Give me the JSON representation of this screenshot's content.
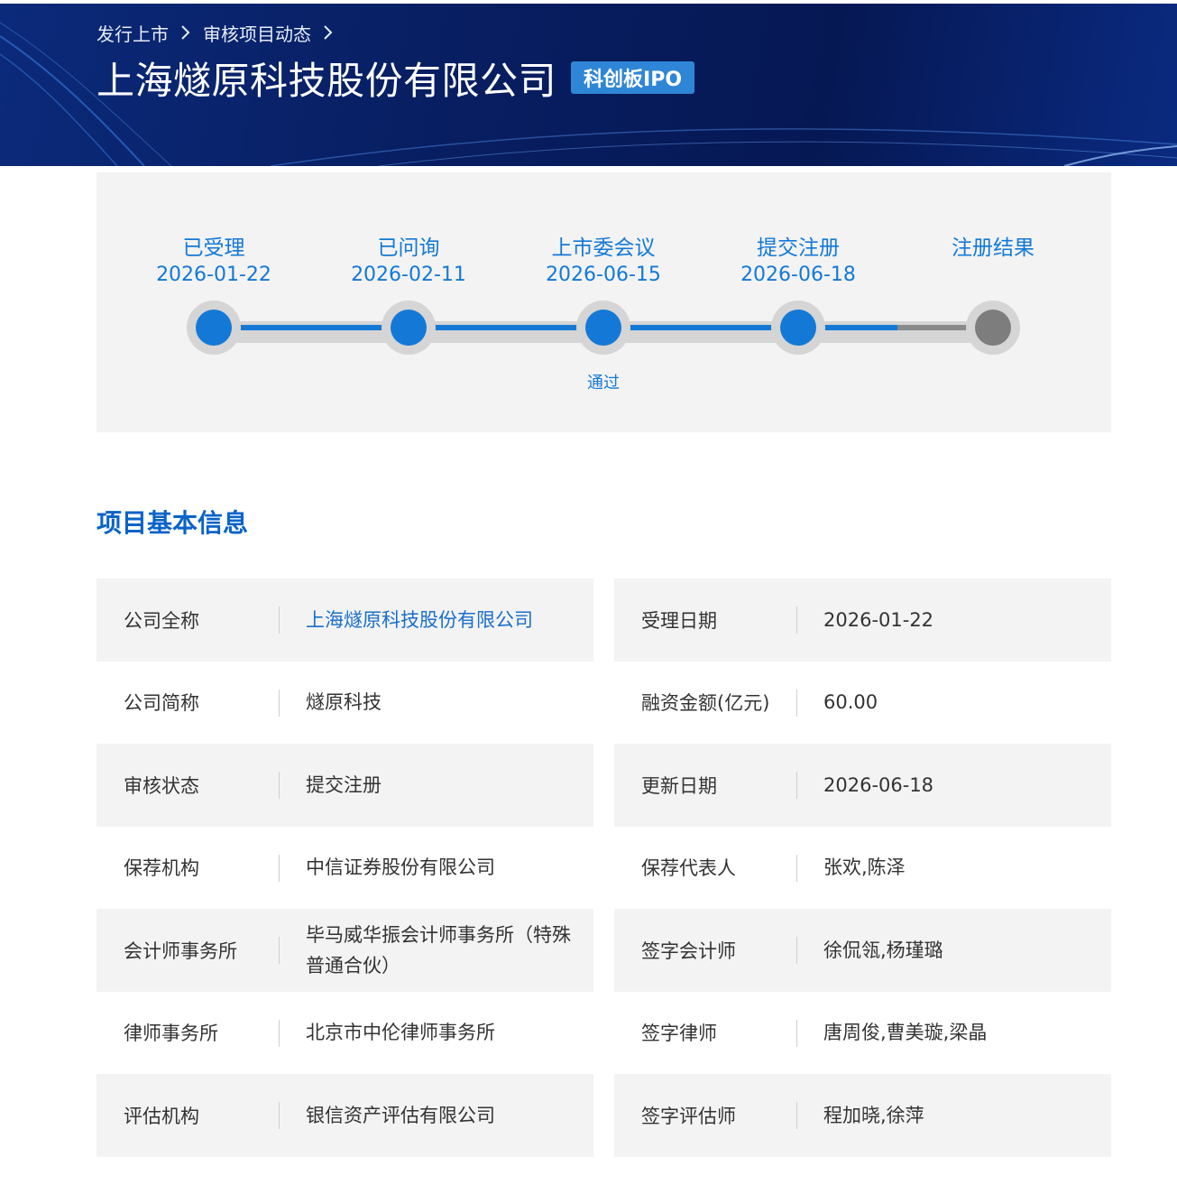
{
  "breadcrumb": {
    "items": [
      "发行上市",
      "审核项目动态"
    ]
  },
  "header": {
    "title": "上海燧原科技股份有限公司",
    "badge": "科创板IPO"
  },
  "progress": {
    "steps": [
      {
        "label": "已受理",
        "date": "2026-01-22",
        "state": "done",
        "note": ""
      },
      {
        "label": "已问询",
        "date": "2026-02-11",
        "state": "done",
        "note": ""
      },
      {
        "label": "上市委会议",
        "date": "2026-06-15",
        "state": "done",
        "note": "通过"
      },
      {
        "label": "提交注册",
        "date": "2026-06-18",
        "state": "done",
        "note": ""
      },
      {
        "label": "注册结果",
        "date": "",
        "state": "pending",
        "note": ""
      }
    ],
    "colors": {
      "done": "#1479d6",
      "pending": "#7d7d7d"
    }
  },
  "section": {
    "title": "项目基本信息"
  },
  "info": {
    "rows": [
      {
        "left": {
          "label": "公司全称",
          "value": "上海燧原科技股份有限公司"
        },
        "right": {
          "label": "受理日期",
          "value": "2026-01-22"
        }
      },
      {
        "left": {
          "label": "公司简称",
          "value": "燧原科技"
        },
        "right": {
          "label": "融资金额(亿元)",
          "value": "60.00"
        }
      },
      {
        "left": {
          "label": "审核状态",
          "value": "提交注册"
        },
        "right": {
          "label": "更新日期",
          "value": "2026-06-18"
        }
      },
      {
        "left": {
          "label": "保荐机构",
          "value": "中信证券股份有限公司"
        },
        "right": {
          "label": "保荐代表人",
          "value": "张欢,陈泽"
        }
      },
      {
        "left": {
          "label": "会计师事务所",
          "value": "毕马威华振会计师事务所（特殊普通合伙）"
        },
        "right": {
          "label": "签字会计师",
          "value": "徐侃瓴,杨瑾璐"
        }
      },
      {
        "left": {
          "label": "律师事务所",
          "value": "北京市中伦律师事务所"
        },
        "right": {
          "label": "签字律师",
          "value": "唐周俊,曹美璇,梁晶"
        }
      },
      {
        "left": {
          "label": "评估机构",
          "value": "银信资产评估有限公司"
        },
        "right": {
          "label": "签字评估师",
          "value": "程加晓,徐萍"
        }
      }
    ]
  }
}
